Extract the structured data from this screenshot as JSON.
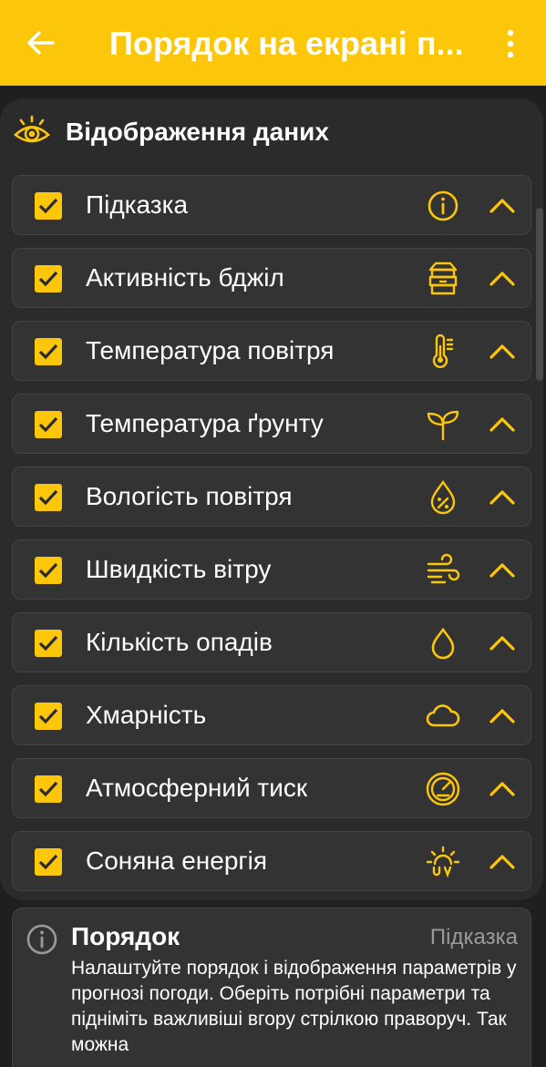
{
  "app_bar": {
    "title": "Порядок на екрані п...",
    "back_icon": "arrow-left-icon",
    "menu_icon": "more-vert-icon",
    "color": "#fcc60b"
  },
  "section": {
    "title": "Відображення даних",
    "icon": "eye-icon"
  },
  "items": [
    {
      "label": "Підказка",
      "checked": true,
      "icon": "info-icon"
    },
    {
      "label": "Активність бджіл",
      "checked": true,
      "icon": "beehive-icon"
    },
    {
      "label": "Температура повітря",
      "checked": true,
      "icon": "thermometer-icon"
    },
    {
      "label": "Температура ґрунту",
      "checked": true,
      "icon": "sprout-icon"
    },
    {
      "label": "Вологість повітря",
      "checked": true,
      "icon": "humidity-drop-icon"
    },
    {
      "label": "Швидкість вітру",
      "checked": true,
      "icon": "wind-icon"
    },
    {
      "label": "Кількість опадів",
      "checked": true,
      "icon": "drop-icon"
    },
    {
      "label": "Хмарність",
      "checked": true,
      "icon": "cloud-icon"
    },
    {
      "label": "Атмосферний тиск",
      "checked": true,
      "icon": "gauge-icon"
    },
    {
      "label": "Соняна енергія",
      "checked": true,
      "icon": "sun-uv-icon"
    }
  ],
  "hint": {
    "title": "Порядок",
    "badge": "Підказка",
    "text": "Налаштуйте порядок і відображення параметрів у прогнозі погоди. Оберіть потрібні параметри та підніміть важливіші вгору стрілкою праворуч. Так можна",
    "icon": "info-outline-icon"
  },
  "colors": {
    "accent": "#fcc60b",
    "background": "#1f1f1f",
    "panel": "#2b2b2b",
    "row": "#333333"
  }
}
